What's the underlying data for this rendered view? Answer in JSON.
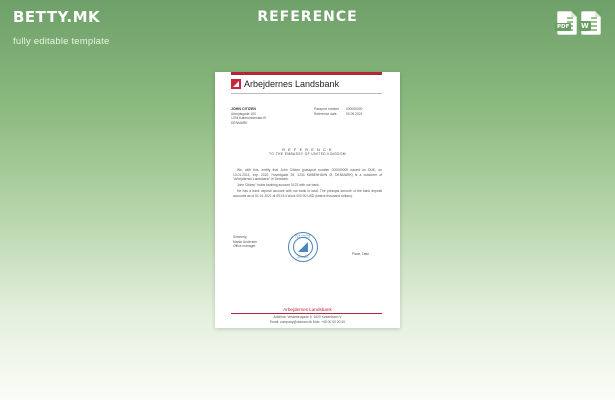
{
  "brand": {
    "logo": "BETTY.MK",
    "tagline": "fully editable template"
  },
  "banner": {
    "title": "REFERENCE"
  },
  "file_icons": [
    {
      "name": "pdf-icon",
      "label": "PDF"
    },
    {
      "name": "word-icon",
      "label": "W"
    }
  ],
  "document": {
    "bank_name": "Arbejdernes Landsbank",
    "addressee": {
      "name": "JOHN CITIZEN",
      "line1": "Arbejdsgade 100",
      "line2": "1234 Københavnstad Ø",
      "line3": "DENMARK"
    },
    "passport": {
      "label": "Passport number",
      "value": "000000000",
      "date_label": "Reference date",
      "date_value": "00.00.2021"
    },
    "ref_title": "R E F E R E N C E",
    "ref_subtitle": "TO THE EMBASSY OF UNITED KINGDOM",
    "paragraph1": "We, with this, certify that John Citizen (passport number 000000000 issued on DUE, on 13.01.2014, exp. 2022, Hovedgade 25, 1234 KØBENHAVN Ø, DENMARK) is a customer of \"Arbejdernes Landsbank\" in Denmark.",
    "paragraph2": "John Citizen\" holds banking account 0123 with our bank.",
    "paragraph3": "He has a bank deposit account with our bank in total. The principal amount of the bank deposit accounts as of 01.01.2021 at 09:15 o'clock 000.00 USD (twelve thousand dollars).",
    "sign": {
      "closing": "Sincerely,",
      "signer": "Martin Andersen",
      "title": "Office manager"
    },
    "seal": {
      "top": "ARBEJDERNES LANDSBANK",
      "bottom": "DENMARK"
    },
    "place": "Place, Date",
    "footer": {
      "name": "Arbejdernes Landsbank",
      "address": "Address: Vesterbrogade 5, 1620 København V",
      "contact": "Email: company@domain.dk  Mob: +45 00 00 00 00"
    }
  }
}
